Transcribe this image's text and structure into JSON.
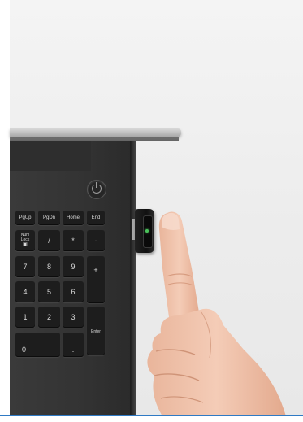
{
  "keypad": {
    "pgup": "PgUp",
    "pgdn": "PgDn",
    "home": "Home",
    "end": "End",
    "numlock_line1": "Num",
    "numlock_line2": "Lock",
    "slash": "/",
    "asterisk": "*",
    "minus": "-",
    "seven": "7",
    "eight": "8",
    "nine": "9",
    "plus": "+",
    "four": "4",
    "five": "5",
    "six": "6",
    "one": "1",
    "two": "2",
    "three": "3",
    "enter": "Enter",
    "zero": "0",
    "dot": "."
  },
  "icons": {
    "power": "power-icon",
    "numlock": "lock-icon"
  },
  "colors": {
    "background": "#ececec",
    "laptop_body": "#333333",
    "key": "#1d1d1d",
    "led": "#4bc35b",
    "skin": "#f0c2aa",
    "accent_line": "#2f7ac4"
  }
}
